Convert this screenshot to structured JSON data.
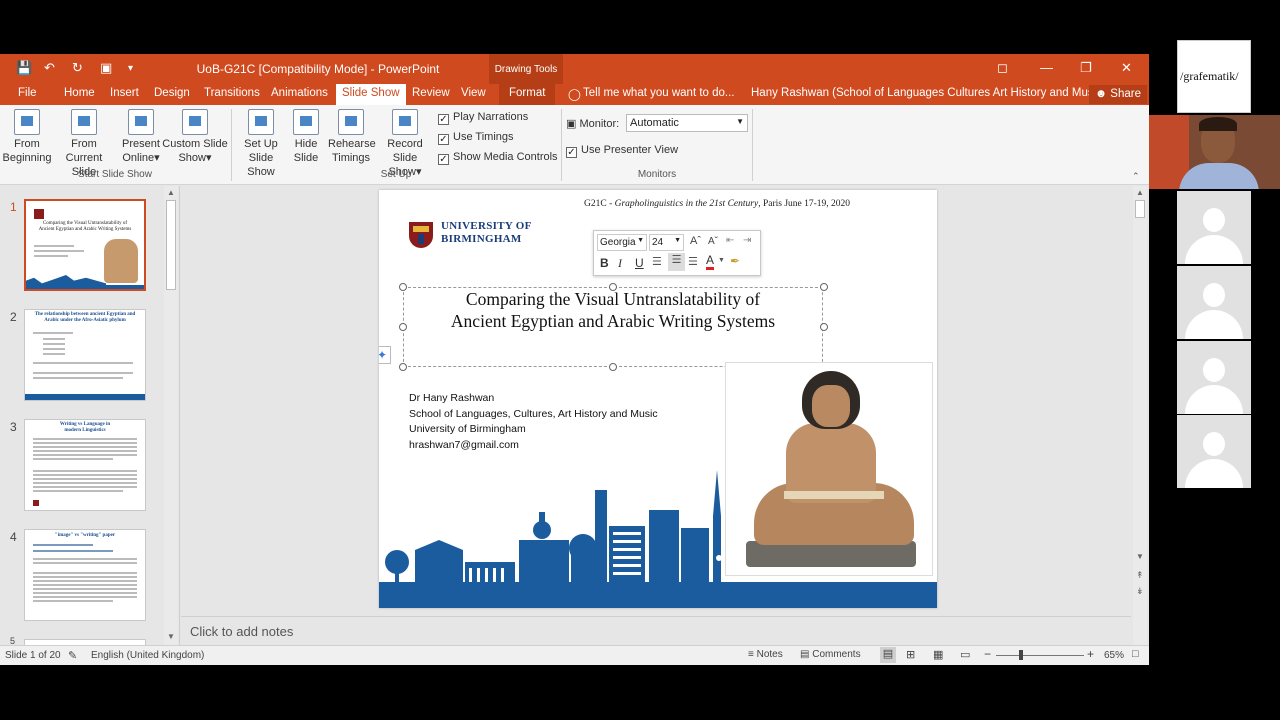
{
  "window": {
    "title": "UoB-G21C [Compatibility Mode] - PowerPoint",
    "drawing_tools": "Drawing Tools",
    "tell_me": "Tell me what you want to do...",
    "user": "Hany Rashwan (School of Languages Cultures Art History and Music)",
    "share": "Share"
  },
  "tabs": [
    "File",
    "Home",
    "Insert",
    "Design",
    "Transitions",
    "Animations",
    "Slide Show",
    "Review",
    "View",
    "Format"
  ],
  "ribbon": {
    "start_group": "Start Slide Show",
    "setup_group": "Set Up",
    "monitors_group": "Monitors",
    "from_beginning": [
      "From",
      "Beginning"
    ],
    "current_slide": [
      "From",
      "Current Slide"
    ],
    "present_online": [
      "Present",
      "Online"
    ],
    "custom_show": [
      "Custom Slide",
      "Show"
    ],
    "setup_show": [
      "Set Up",
      "Slide Show"
    ],
    "hide_slide": [
      "Hide",
      "Slide"
    ],
    "rehearse": [
      "Rehearse",
      "Timings"
    ],
    "record": [
      "Record Slide",
      "Show"
    ],
    "play_narrations": "Play Narrations",
    "use_timings": "Use Timings",
    "show_media_controls": "Show Media Controls",
    "monitor_label": "Monitor:",
    "monitor_value": "Automatic",
    "presenter_view": "Use Presenter View"
  },
  "thumbnails": [
    {
      "num": "1",
      "title": "Comparing the Visual Untranslatability of Ancient Egyptian and Arabic Writing Systems"
    },
    {
      "num": "2",
      "title": "The relationship between ancient Egyptian and Arabic under the Afro-Asiatic phylum"
    },
    {
      "num": "3",
      "title": "Writing vs Language in modern Linguistics"
    },
    {
      "num": "4",
      "title": "\"image\" vs \"writing\" paper"
    },
    {
      "num": "5",
      "title": ""
    }
  ],
  "slide": {
    "conference_pre": "G21C - ",
    "conference_italic": "Grapholinguistics in the 21st Century",
    "conference_post": ", Paris June 17-19, 2020",
    "uni_line1": "UNIVERSITY OF",
    "uni_line2": "BIRMINGHAM",
    "title_line1": "Comparing the Visual Untranslatability of",
    "title_line2": "Ancient Egyptian and Arabic Writing Systems",
    "author": "Dr Hany Rashwan",
    "school": "School of Languages, Cultures, Art History and Music",
    "university": "University of Birmingham",
    "email": "hrashwan7@gmail.com"
  },
  "minitoolbar": {
    "font": "Georgia",
    "size": "24",
    "bold": "B",
    "italic": "I",
    "underline": "U"
  },
  "notes_placeholder": "Click to add notes",
  "status": {
    "slide_info": "Slide 1 of 20",
    "language": "English (United Kingdom)",
    "notes": "Notes",
    "comments": "Comments",
    "zoom": "65%"
  },
  "video": {
    "presenter_tag": "/grafematik/"
  },
  "colors": {
    "ppt_accent": "#d04a1f",
    "uob_blue": "#1a5c9e"
  }
}
